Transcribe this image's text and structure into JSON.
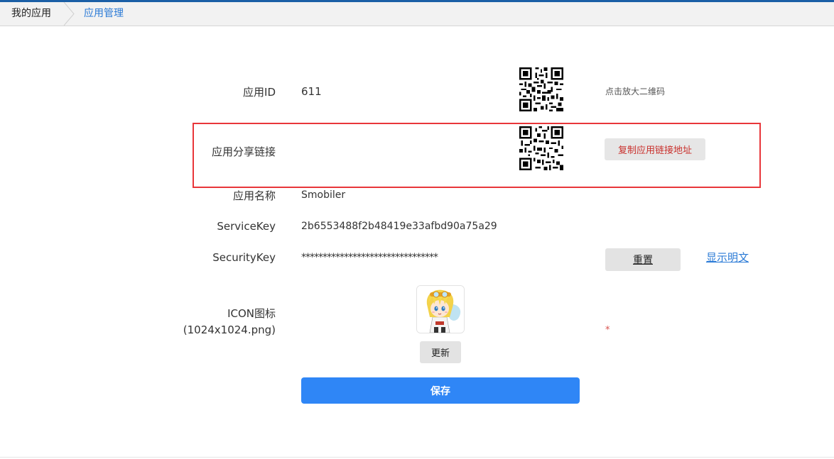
{
  "breadcrumb": {
    "home": "我的应用",
    "current": "应用管理"
  },
  "form": {
    "app_id": {
      "label": "应用ID",
      "value": "611",
      "qr_hint": "点击放大二维码"
    },
    "share_link": {
      "label": "应用分享链接",
      "copy_button": "复制应用链接地址"
    },
    "app_name": {
      "label": "应用名称",
      "value": "Smobiler"
    },
    "service_key": {
      "label": "ServiceKey",
      "value": "2b6553488f2b48419e33afbd90a75a29"
    },
    "security_key": {
      "label": "SecurityKey",
      "value": "********************************",
      "reset_button": "重置",
      "show_link": "显示明文"
    },
    "icon": {
      "label_line1": "ICON图标",
      "label_line2": "(1024x1024.png)",
      "update_button": "更新",
      "required_mark": "*"
    },
    "save_button": "保存"
  },
  "colors": {
    "accent": "#2f86f6",
    "link": "#2a7ad6",
    "highlight": "#e8363a",
    "copy_text": "#c9302c"
  },
  "icons": {
    "qr_1": "qr-code-icon",
    "qr_2": "qr-code-icon",
    "app_icon": "anime-character-avatar"
  }
}
